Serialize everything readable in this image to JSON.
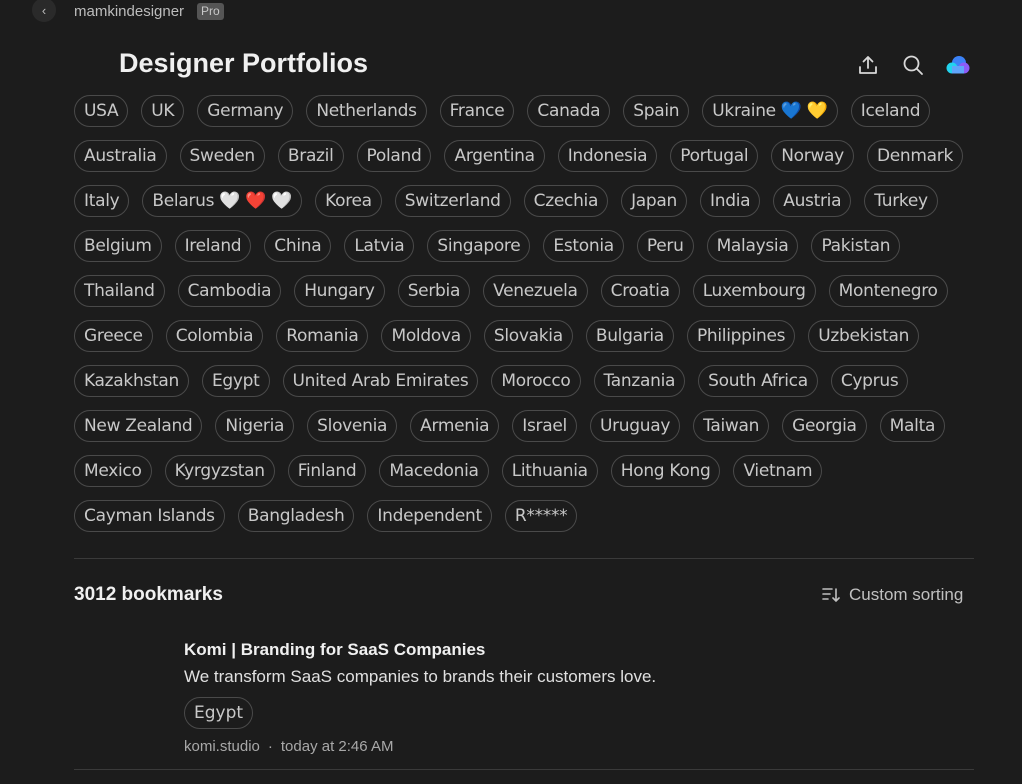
{
  "topbar": {
    "back_icon": "chevron-left-icon",
    "owner": "mamkindesigner",
    "badge": "Pro"
  },
  "header": {
    "title": "Designer Portfolios",
    "icons": [
      "share-upload-icon",
      "search-icon",
      "cloud-app-icon"
    ]
  },
  "tags": [
    "USA",
    "UK",
    "Germany",
    "Netherlands",
    "France",
    "Canada",
    "Spain",
    "Ukraine 💙 💛",
    "Iceland",
    "Australia",
    "Sweden",
    "Brazil",
    "Poland",
    "Argentina",
    "Indonesia",
    "Portugal",
    "Norway",
    "Denmark",
    "Italy",
    "Belarus 🤍 ❤️ 🤍",
    "Korea",
    "Switzerland",
    "Czechia",
    "Japan",
    "India",
    "Austria",
    "Turkey",
    "Belgium",
    "Ireland",
    "China",
    "Latvia",
    "Singapore",
    "Estonia",
    "Peru",
    "Malaysia",
    "Pakistan",
    "Thailand",
    "Cambodia",
    "Hungary",
    "Serbia",
    "Venezuela",
    "Croatia",
    "Luxembourg",
    "Montenegro",
    "Greece",
    "Colombia",
    "Romania",
    "Moldova",
    "Slovakia",
    "Bulgaria",
    "Philippines",
    "Uzbekistan",
    "Kazakhstan",
    "Egypt",
    "United Arab Emirates",
    "Morocco",
    "Tanzania",
    "South Africa",
    "Cyprus",
    "New Zealand",
    "Nigeria",
    "Slovenia",
    "Armenia",
    "Israel",
    "Uruguay",
    "Taiwan",
    "Georgia",
    "Malta",
    "Mexico",
    "Kyrgyzstan",
    "Finland",
    "Macedonia",
    "Lithuania",
    "Hong Kong",
    "Vietnam",
    "Cayman Islands",
    "Bangladesh",
    "Independent",
    "R*****"
  ],
  "list": {
    "count_label": "3012 bookmarks",
    "sort_label": "Custom sorting",
    "sort_icon": "sort-icon"
  },
  "bookmark": {
    "title": "Komi | Branding for SaaS Companies",
    "description": "We transform SaaS companies to brands their customers love.",
    "tag": "Egypt",
    "domain": "komi.studio",
    "separator": "·",
    "time": "today at 2:46 AM"
  },
  "colors": {
    "background": "#1c1c1c",
    "tag_border": "#4a4a4a",
    "accent_cloud": "#3b82f6"
  }
}
